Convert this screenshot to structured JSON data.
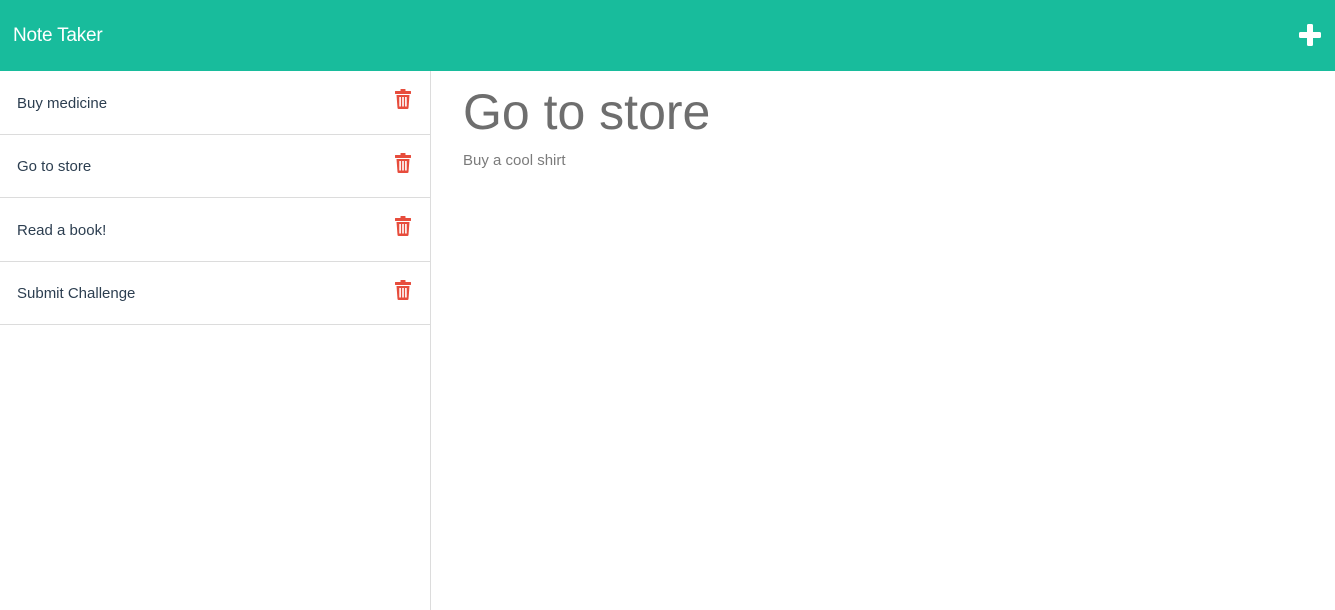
{
  "header": {
    "brand": "Note Taker",
    "new_note_icon": "plus-icon",
    "background_color": "#18bc9c"
  },
  "sidebar": {
    "notes": [
      {
        "title": "Buy medicine",
        "delete_icon": "trash-icon"
      },
      {
        "title": "Go to store",
        "delete_icon": "trash-icon"
      },
      {
        "title": "Read a book!",
        "delete_icon": "trash-icon"
      },
      {
        "title": "Submit Challenge",
        "delete_icon": "trash-icon"
      }
    ],
    "delete_icon_color": "#e74c3c"
  },
  "editor": {
    "title": "Go to store",
    "body": "Buy a cool shirt"
  }
}
